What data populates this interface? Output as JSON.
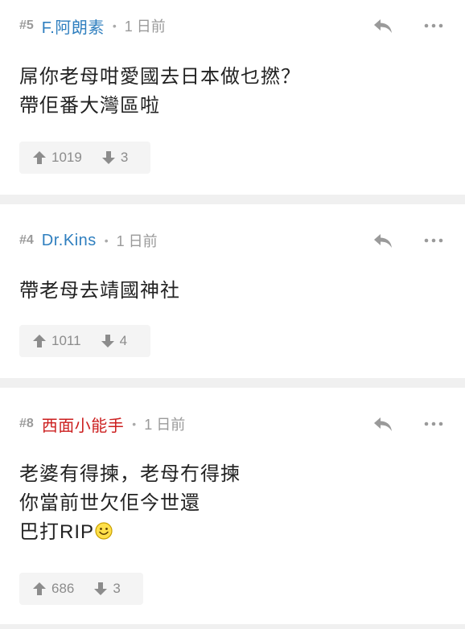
{
  "colors": {
    "accent_blue": "#2f7fbf",
    "accent_red": "#cc1f1f",
    "meta_gray": "#9a9a9a",
    "icon_gray": "#8c8c8c",
    "separator": "#f0f0f0",
    "vote_bg": "#f4f4f4"
  },
  "icons": {
    "reply": "reply-arrow-icon",
    "more": "more-dots-icon",
    "upvote": "arrow-up-icon",
    "downvote": "arrow-down-icon",
    "emoji": "smiley-icon"
  },
  "comments": [
    {
      "number": "#5",
      "username": "F.阿朗素",
      "username_color": "#2f7fbf",
      "separator_dot": "•",
      "time": "1 日前",
      "lines": [
        "屌你老母咁愛國去日本做乜撚？",
        "帶佢番大灣區啦"
      ],
      "upvotes": "1019",
      "downvotes": "3"
    },
    {
      "number": "#4",
      "username": "Dr.Kins",
      "username_color": "#2f7fbf",
      "separator_dot": "•",
      "time": "1 日前",
      "lines": [
        "帶老母去靖國神社"
      ],
      "upvotes": "1011",
      "downvotes": "4"
    },
    {
      "number": "#8",
      "username": "西面小能手",
      "username_color": "#cc1f1f",
      "separator_dot": "•",
      "time": "1 日前",
      "lines": [
        "老婆有得揀，老母冇得揀",
        "你當前世欠佢今世還",
        "巴打RIP"
      ],
      "upvotes": "686",
      "downvotes": "3"
    }
  ]
}
